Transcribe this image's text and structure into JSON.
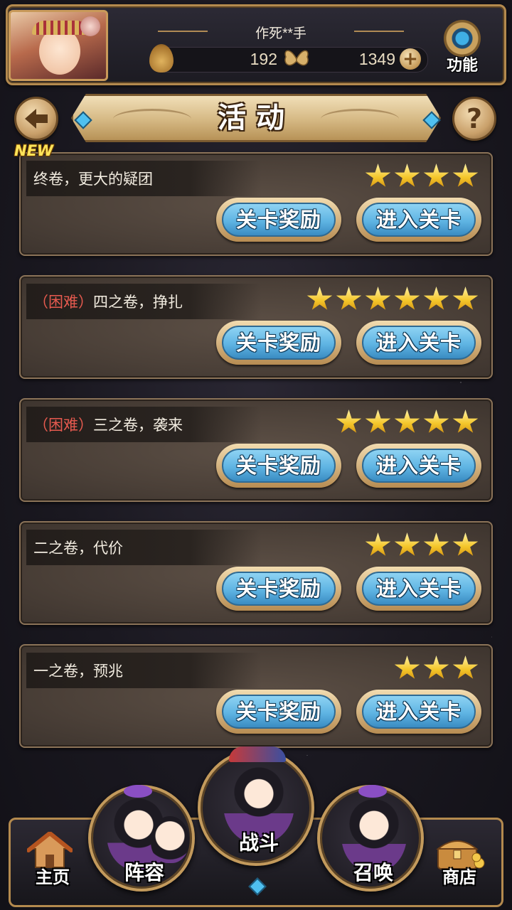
{
  "header": {
    "player_name": "作死**手",
    "resource1_value": "192",
    "resource2_value": "1349",
    "function_label": "功能"
  },
  "page_title": "活动",
  "help_label": "?",
  "new_badge": "NEW",
  "buttons": {
    "reward_label": "关卡奖励",
    "enter_label": "进入关卡"
  },
  "levels": [
    {
      "difficulty": "",
      "title": "终卷，更大的疑团",
      "stars": 4
    },
    {
      "difficulty": "（困难）",
      "title": "四之卷，挣扎",
      "stars": 6
    },
    {
      "difficulty": "（困难）",
      "title": "三之卷，袭来",
      "stars": 5
    },
    {
      "difficulty": "",
      "title": "二之卷，代价",
      "stars": 4
    },
    {
      "difficulty": "",
      "title": "一之卷，预兆",
      "stars": 3
    }
  ],
  "nav": {
    "home": "主页",
    "lineup": "阵容",
    "battle": "战斗",
    "summon": "召唤",
    "shop": "商店"
  },
  "colors": {
    "accent_gold": "#b48a4e",
    "button_blue": "#5fb4e3",
    "hard_red": "#e65a4f",
    "star_gold": "#f4c62a"
  }
}
